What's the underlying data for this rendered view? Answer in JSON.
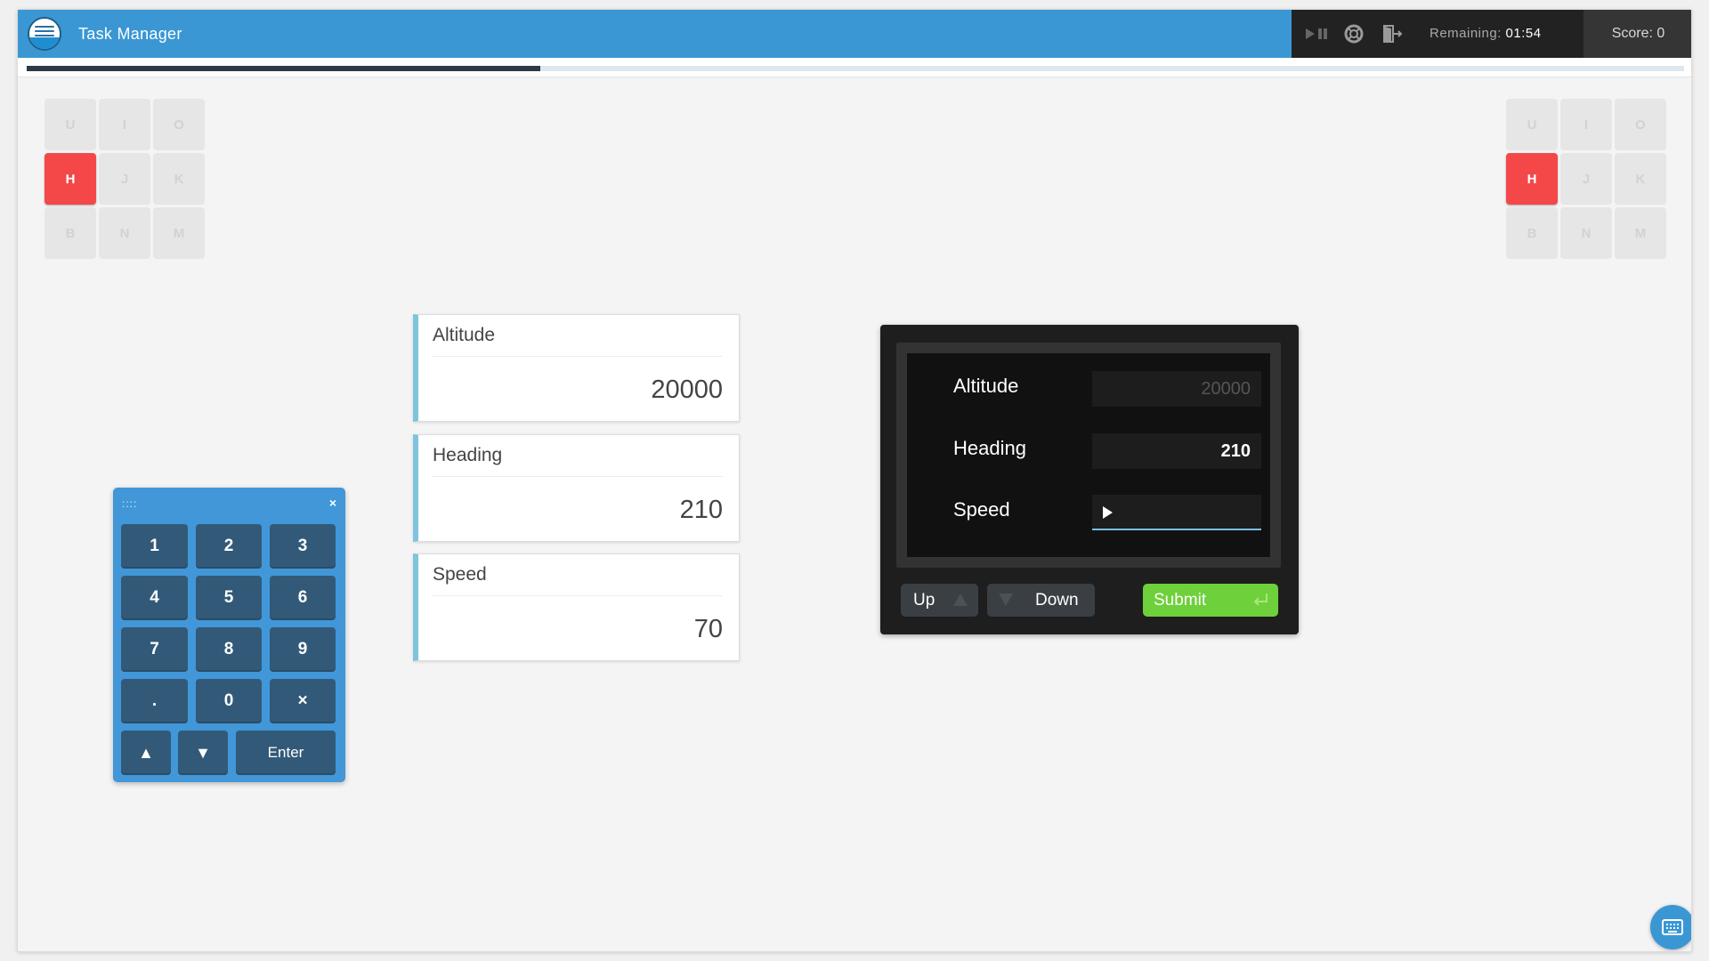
{
  "window": {
    "title": "Task Manager"
  },
  "controls": {
    "play_pause_icon": "play-pause-icon",
    "help_icon": "lifebuoy-icon",
    "exit_icon": "exit-door-icon",
    "remaining_label": "Remaining:",
    "remaining_time": "01:54",
    "score_text": "Score: 0"
  },
  "progress": {
    "fraction": 0.31
  },
  "key_grid_left": {
    "keys": [
      "U",
      "I",
      "O",
      "H",
      "J",
      "K",
      "B",
      "N",
      "M"
    ],
    "active": "H"
  },
  "key_grid_right": {
    "keys": [
      "U",
      "I",
      "O",
      "H",
      "J",
      "K",
      "B",
      "N",
      "M"
    ],
    "active": "H"
  },
  "numpad": {
    "grip": "::::",
    "close": "×",
    "keys": [
      "1",
      "2",
      "3",
      "4",
      "5",
      "6",
      "7",
      "8",
      "9",
      ".",
      "0",
      "×"
    ],
    "up": "▲",
    "down": "▼",
    "enter": "Enter"
  },
  "targets": [
    {
      "label": "Altitude",
      "value": "20000"
    },
    {
      "label": "Heading",
      "value": "210"
    },
    {
      "label": "Speed",
      "value": "70"
    }
  ],
  "entry_panel": {
    "fields": [
      {
        "label": "Altitude",
        "value": "20000",
        "state": "placeholder"
      },
      {
        "label": "Heading",
        "value": "210",
        "state": "set"
      },
      {
        "label": "Speed",
        "value": "",
        "state": "active"
      }
    ],
    "up_label": "Up",
    "down_label": "Down",
    "submit_label": "Submit",
    "submit_icon": "enter-return-icon",
    "accent": "#6ed03a"
  },
  "colors": {
    "titlebar": "#3a97d4",
    "active_key": "#f44848",
    "card_accent": "#7fc4de",
    "numpad": "#4197d8",
    "numpad_key": "#325a78"
  }
}
